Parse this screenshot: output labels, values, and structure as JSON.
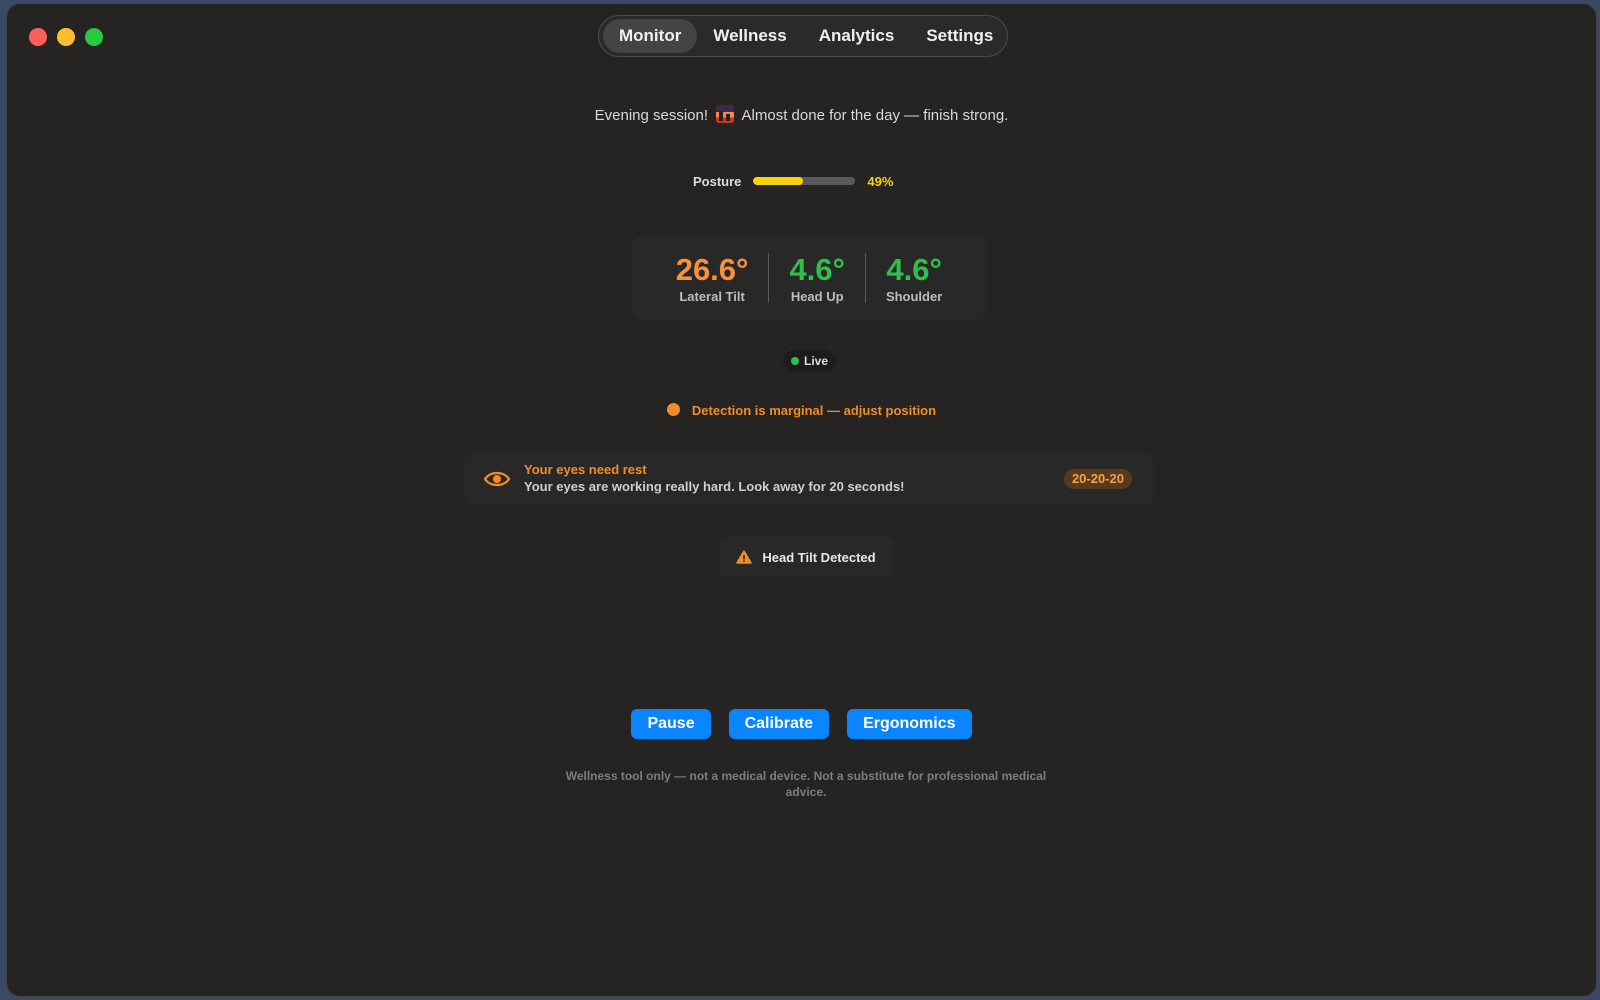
{
  "colors": {
    "warning": "#f28c28",
    "good": "#30c04a",
    "accent": "#0a84ff",
    "posture_bar": "#f5d20a"
  },
  "tabs": [
    {
      "label": "Monitor",
      "active": true
    },
    {
      "label": "Wellness",
      "active": false
    },
    {
      "label": "Analytics",
      "active": false
    },
    {
      "label": "Settings",
      "active": false
    }
  ],
  "greeting": {
    "prefix": "Evening session!",
    "emoji_icon": "sunset-icon",
    "suffix": "Almost done for the day — finish strong."
  },
  "posture": {
    "label": "Posture",
    "value_text": "49%",
    "fraction": 0.49
  },
  "metrics": [
    {
      "value": "26.6°",
      "label": "Lateral Tilt",
      "color": "#f7923a"
    },
    {
      "value": "4.6°",
      "label": "Head Up",
      "color": "#30c04a"
    },
    {
      "value": "4.6°",
      "label": "Shoulder",
      "color": "#30c04a"
    }
  ],
  "live": {
    "label": "Live"
  },
  "detection": {
    "text": "Detection is marginal — adjust position"
  },
  "eye_rest": {
    "icon": "eye-icon",
    "title": "Your eyes need rest",
    "message": "Your eyes are working really hard. Look away for 20 seconds!",
    "badge": "20-20-20"
  },
  "alert": {
    "icon": "warning-icon",
    "text": "Head Tilt Detected"
  },
  "actions": {
    "pause": "Pause",
    "calibrate": "Calibrate",
    "ergonomics": "Ergonomics"
  },
  "disclaimer": "Wellness tool only — not a medical device. Not a substitute for professional medical advice."
}
